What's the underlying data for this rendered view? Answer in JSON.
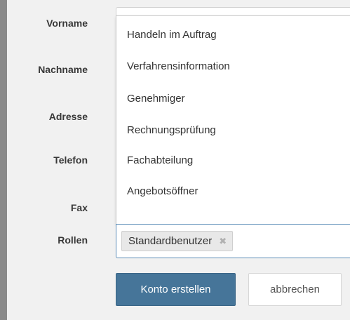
{
  "form": {
    "labels": {
      "first_name": "Vorname",
      "last_name": "Nachname",
      "address": "Adresse",
      "phone": "Telefon",
      "fax": "Fax",
      "roles": "Rollen"
    },
    "roles_dropdown": {
      "options": [
        "Handeln im Auftrag",
        "Verfahrensinformation",
        "Genehmiger",
        "Rechnungsprüfung",
        "Fachabteilung",
        "Angebotsöffner"
      ]
    },
    "roles_selected": {
      "tag_label": "Standardbenutzer",
      "remove_symbol": "✖"
    },
    "buttons": {
      "create": "Konto erstellen",
      "cancel": "abbrechen"
    }
  },
  "colors": {
    "primary_button": "#467599",
    "focus_border": "#5b8cb7",
    "panel_background": "#f1f1f1"
  }
}
